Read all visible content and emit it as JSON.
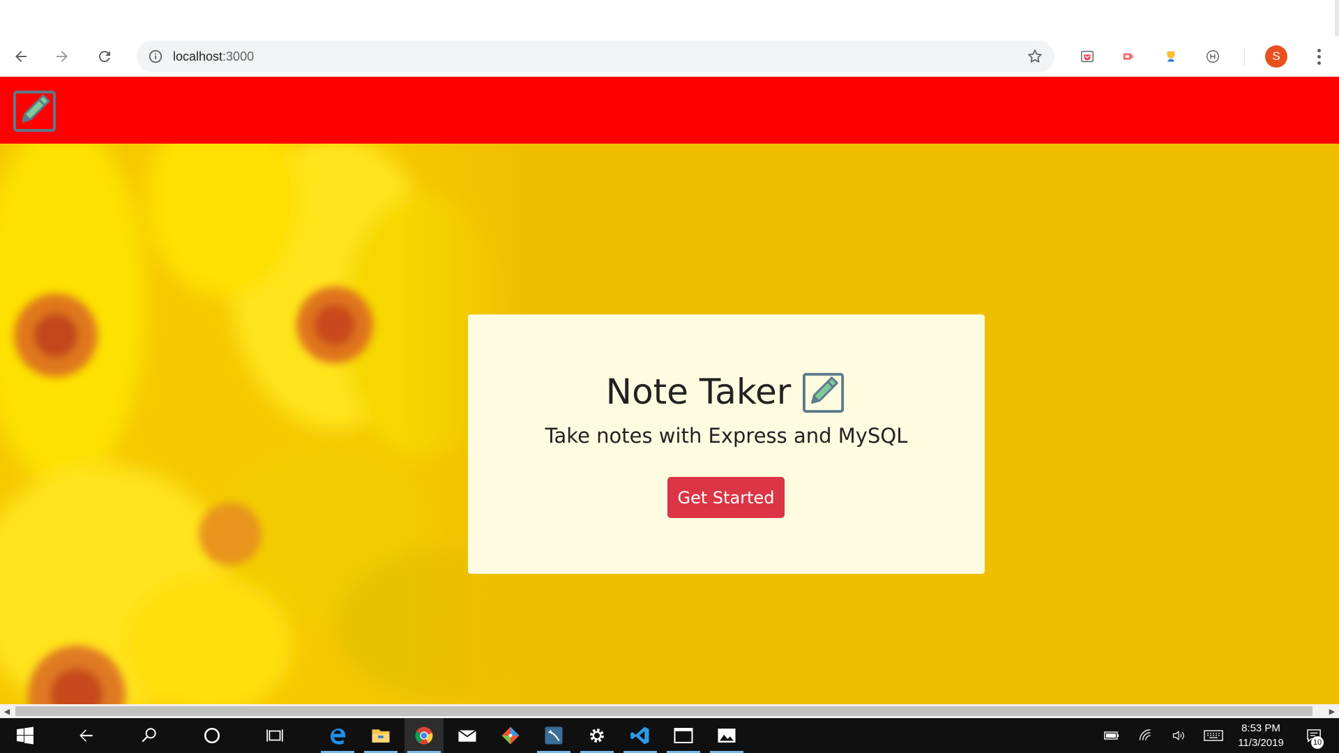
{
  "browser": {
    "url_host": "localhost",
    "url_port": ":3000",
    "profile_initial": "S",
    "extensions": [
      "pocket-icon",
      "cast-icon",
      "trophy-icon",
      "honey-icon"
    ]
  },
  "navbar": {
    "brand_icon": "edit-note-icon",
    "background": "#ff0000"
  },
  "hero": {
    "background": "#f0be00",
    "title": "Note Taker",
    "title_icon": "edit-note-icon",
    "subtitle": "Take notes with Express and MySQL",
    "cta_label": "Get Started",
    "cta_color": "#dc3545",
    "card_background": "#fefce0"
  },
  "taskbar": {
    "apps": [
      "start-icon",
      "back-icon",
      "search-icon",
      "cortana-icon",
      "task-view-icon",
      "edge-icon",
      "file-explorer-icon",
      "chrome-icon",
      "mail-icon",
      "git-icon",
      "mysql-workbench-icon",
      "settings-icon",
      "vscode-icon",
      "terminal-icon",
      "photos-icon"
    ],
    "time": "8:53 PM",
    "date": "11/3/2019",
    "notification_count": "10"
  }
}
